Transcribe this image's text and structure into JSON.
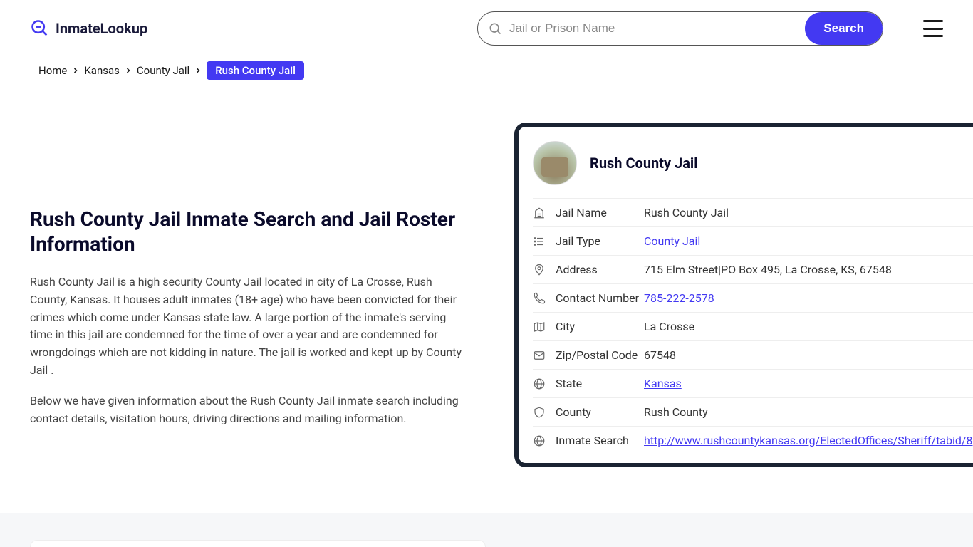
{
  "header": {
    "logo_text": "InmateLookup",
    "search_placeholder": "Jail or Prison Name",
    "search_button": "Search"
  },
  "breadcrumb": {
    "items": [
      "Home",
      "Kansas",
      "County Jail"
    ],
    "current": "Rush County Jail"
  },
  "content": {
    "heading": "Rush County Jail Inmate Search and Jail Roster Information",
    "para1": "Rush County Jail is a high security County Jail located in city of La Crosse, Rush County, Kansas. It houses adult inmates (18+ age) who have been convicted for their crimes which come under Kansas state law. A large portion of the inmate's serving time in this jail are condemned for the time of over a year and are condemned for wrongdoings which are not kidding in nature. The jail is worked and kept up by County Jail .",
    "para2": "Below we have given information about the Rush County Jail inmate search including contact details, visitation hours, driving directions and mailing information."
  },
  "card": {
    "title": "Rush County Jail",
    "rows": [
      {
        "icon": "building-icon",
        "label": "Jail Name",
        "value": "Rush County Jail",
        "link": false
      },
      {
        "icon": "list-icon",
        "label": "Jail Type",
        "value": "County Jail",
        "link": true
      },
      {
        "icon": "pin-icon",
        "label": "Address",
        "value": "715 Elm Street|PO Box 495, La Crosse, KS, 67548",
        "link": false
      },
      {
        "icon": "phone-icon",
        "label": "Contact Number",
        "value": "785-222-2578",
        "link": true
      },
      {
        "icon": "map-icon",
        "label": "City",
        "value": "La Crosse",
        "link": false
      },
      {
        "icon": "mail-icon",
        "label": "Zip/Postal Code",
        "value": "67548",
        "link": false
      },
      {
        "icon": "globe-icon",
        "label": "State",
        "value": "Kansas",
        "link": true
      },
      {
        "icon": "shield-icon",
        "label": "County",
        "value": "Rush County",
        "link": false
      },
      {
        "icon": "web-icon",
        "label": "Inmate Search",
        "value": "http://www.rushcountykansas.org/ElectedOffices/Sheriff/tabid/8",
        "link": true
      }
    ]
  }
}
